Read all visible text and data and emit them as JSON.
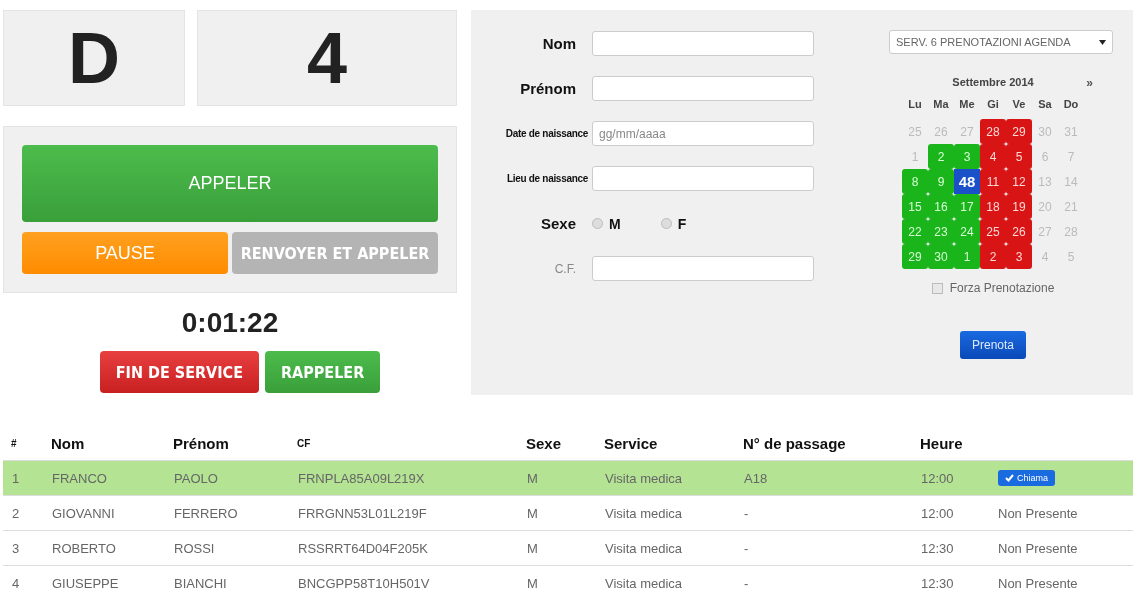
{
  "ticket": {
    "letter": "D",
    "number": "4"
  },
  "actions": {
    "main": {
      "label": "APPELER",
      "disabled": false
    },
    "pause": {
      "label": "PAUSE",
      "disabled": false
    },
    "transfer": {
      "label": "RENVOYER ET APPELER",
      "disabled": true
    }
  },
  "timer": "0:01:22",
  "end_buttons": [
    {
      "label": "FIN DE SERVICE",
      "kind": "danger"
    },
    {
      "label": "RAPPELER",
      "kind": "success"
    }
  ],
  "form": {
    "fields": [
      {
        "label": "Nom",
        "kind": "big"
      },
      {
        "label": "Prénom",
        "kind": "big"
      },
      {
        "label": "Date de naissance",
        "kind": "small",
        "placeholder": "gg/mm/aaaa"
      },
      {
        "label": "Lieu de naissance",
        "kind": "small"
      }
    ],
    "sex": {
      "label": "Sexe",
      "options": [
        {
          "label": "M",
          "checked": false
        },
        {
          "label": "F",
          "checked": false
        }
      ]
    },
    "cf": {
      "label": "C.F."
    }
  },
  "agenda": {
    "service": "SERV. 6 PRENOTAZIONI AGENDA",
    "month": "Settembre 2014",
    "next": "»",
    "weekdays": [
      "Lu",
      "Ma",
      "Me",
      "Gi",
      "Ve",
      "Sa",
      "Do"
    ],
    "weeks": [
      [
        {
          "day": "25",
          "kind": "other"
        },
        {
          "day": "26",
          "kind": "other"
        },
        {
          "day": "27",
          "kind": "other"
        },
        {
          "day": "28",
          "kind": "full"
        },
        {
          "day": "29",
          "kind": "full"
        },
        {
          "day": "30",
          "kind": "other"
        },
        {
          "day": "31",
          "kind": "other"
        }
      ],
      [
        {
          "day": "1",
          "kind": "other"
        },
        {
          "day": "2",
          "kind": "free"
        },
        {
          "day": "3",
          "kind": "free"
        },
        {
          "day": "4",
          "kind": "full"
        },
        {
          "day": "5",
          "kind": "full"
        },
        {
          "day": "6",
          "kind": "other"
        },
        {
          "day": "7",
          "kind": "other"
        }
      ],
      [
        {
          "day": "8",
          "kind": "free"
        },
        {
          "day": "9",
          "kind": "free"
        },
        {
          "day": "48",
          "kind": "selected"
        },
        {
          "day": "11",
          "kind": "full"
        },
        {
          "day": "12",
          "kind": "full"
        },
        {
          "day": "13",
          "kind": "other"
        },
        {
          "day": "14",
          "kind": "other"
        }
      ],
      [
        {
          "day": "15",
          "kind": "free"
        },
        {
          "day": "16",
          "kind": "free"
        },
        {
          "day": "17",
          "kind": "free"
        },
        {
          "day": "18",
          "kind": "full"
        },
        {
          "day": "19",
          "kind": "full"
        },
        {
          "day": "20",
          "kind": "other"
        },
        {
          "day": "21",
          "kind": "other"
        }
      ],
      [
        {
          "day": "22",
          "kind": "free"
        },
        {
          "day": "23",
          "kind": "free"
        },
        {
          "day": "24",
          "kind": "free"
        },
        {
          "day": "25",
          "kind": "full"
        },
        {
          "day": "26",
          "kind": "full"
        },
        {
          "day": "27",
          "kind": "other"
        },
        {
          "day": "28",
          "kind": "other"
        }
      ],
      [
        {
          "day": "29",
          "kind": "free"
        },
        {
          "day": "30",
          "kind": "free"
        },
        {
          "day": "1",
          "kind": "free"
        },
        {
          "day": "2",
          "kind": "full"
        },
        {
          "day": "3",
          "kind": "full"
        },
        {
          "day": "4",
          "kind": "other"
        },
        {
          "day": "5",
          "kind": "other"
        }
      ]
    ],
    "force": {
      "label": "Forza Prenotazione",
      "checked": false
    },
    "submit": "Prenota"
  },
  "table": {
    "columns": [
      "#",
      "Nom",
      "Prénom",
      "CF",
      "Sexe",
      "Service",
      "N° de passage",
      "Heure"
    ],
    "rows": [
      {
        "cells": [
          "1",
          "FRANCO",
          "PAOLO",
          "FRNPLA85A09L219X",
          "M",
          "Visita medica",
          "A18",
          "12:00"
        ],
        "selected": true,
        "action": {
          "kind": "button",
          "label": "Chiama"
        }
      },
      {
        "cells": [
          "2",
          "GIOVANNI",
          "FERRERO",
          "FRRGNN53L01L219F",
          "M",
          "Visita medica",
          "-",
          "12:00"
        ],
        "selected": false,
        "action": {
          "kind": "text",
          "label": "Non Presente"
        }
      },
      {
        "cells": [
          "3",
          "ROBERTO",
          "ROSSI",
          "RSSRRT64D04F205K",
          "M",
          "Visita medica",
          "-",
          "12:30"
        ],
        "selected": false,
        "action": {
          "kind": "text",
          "label": "Non Presente"
        }
      },
      {
        "cells": [
          "4",
          "GIUSEPPE",
          "BIANCHI",
          "BNCGPP58T10H501V",
          "M",
          "Visita medica",
          "-",
          "12:30"
        ],
        "selected": false,
        "action": {
          "kind": "text",
          "label": "Non Presente"
        }
      }
    ]
  }
}
